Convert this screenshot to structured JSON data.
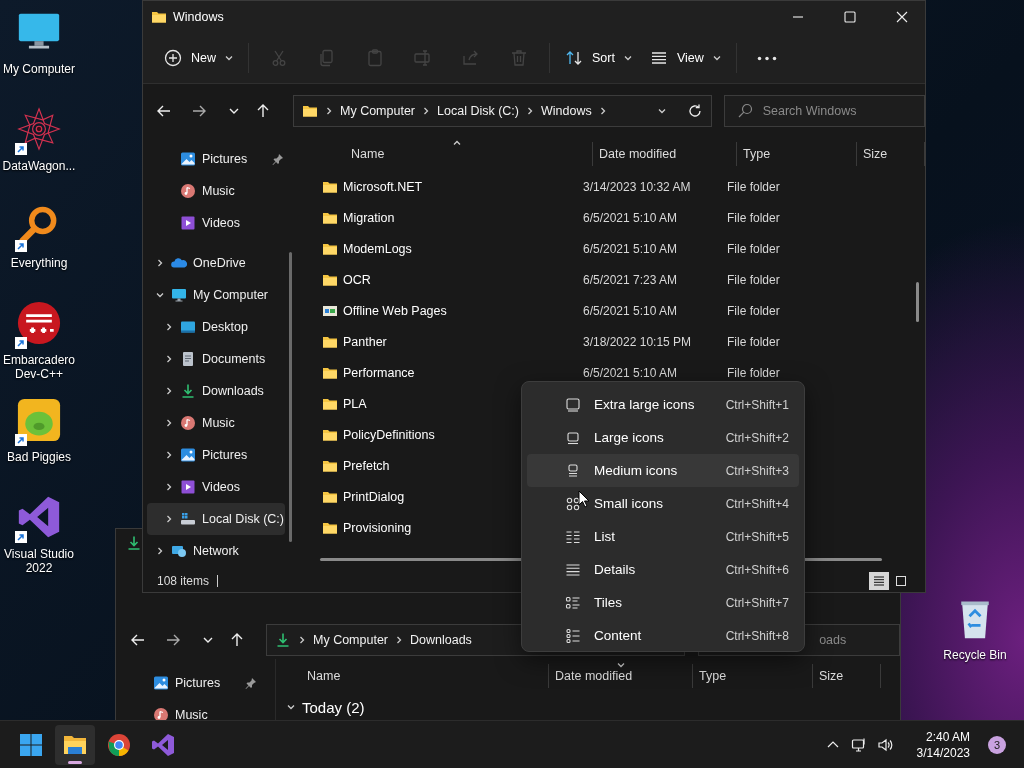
{
  "desktop": {
    "icons": [
      {
        "label": "My Computer",
        "kind": "computer",
        "shortcut": false
      },
      {
        "label": "DataWagon...",
        "kind": "mandala",
        "shortcut": true
      },
      {
        "label": "Everything",
        "kind": "magnifier",
        "shortcut": true
      },
      {
        "label": "Embarcadero Dev-C++",
        "kind": "devcpp",
        "shortcut": true
      },
      {
        "label": "Bad Piggies",
        "kind": "game",
        "shortcut": true
      },
      {
        "label": "Visual Studio 2022",
        "kind": "vs",
        "shortcut": true
      }
    ],
    "recycle_bin": {
      "label": "Recycle Bin"
    }
  },
  "explorer": {
    "title": "Windows",
    "toolbar": [
      {
        "kind": "new",
        "label": "New",
        "disabled": false
      },
      {
        "kind": "cut",
        "disabled": true
      },
      {
        "kind": "copy",
        "disabled": true
      },
      {
        "kind": "paste",
        "disabled": true
      },
      {
        "kind": "rename",
        "disabled": true
      },
      {
        "kind": "share",
        "disabled": true
      },
      {
        "kind": "delete",
        "disabled": true
      },
      {
        "kind": "sort",
        "label": "Sort",
        "disabled": false
      },
      {
        "kind": "view",
        "label": "View",
        "disabled": false
      }
    ],
    "address": [
      "My Computer",
      "Local Disk (C:)",
      "Windows"
    ],
    "search": {
      "placeholder": "Search Windows"
    },
    "quick_access": [
      {
        "label": "Pictures",
        "kind": "pictures",
        "pinned": true
      },
      {
        "label": "Music",
        "kind": "music",
        "pinned": false
      },
      {
        "label": "Videos",
        "kind": "videos",
        "pinned": false
      }
    ],
    "tree": [
      {
        "label": "OneDrive",
        "kind": "onedrive",
        "expanded": false,
        "selected": false
      },
      {
        "label": "My Computer",
        "kind": "computer",
        "expanded": true,
        "selected": false,
        "children": [
          {
            "label": "Desktop",
            "kind": "desktop",
            "expanded": false,
            "selected": false
          },
          {
            "label": "Documents",
            "kind": "documents",
            "expanded": false,
            "selected": false
          },
          {
            "label": "Downloads",
            "kind": "downloads",
            "expanded": false,
            "selected": false
          },
          {
            "label": "Music",
            "kind": "music",
            "expanded": false,
            "selected": false
          },
          {
            "label": "Pictures",
            "kind": "pictures",
            "expanded": false,
            "selected": false
          },
          {
            "label": "Videos",
            "kind": "videos",
            "expanded": false,
            "selected": false
          },
          {
            "label": "Local Disk (C:)",
            "kind": "disk",
            "expanded": false,
            "selected": true
          }
        ]
      },
      {
        "label": "Network",
        "kind": "network",
        "expanded": false,
        "selected": false
      }
    ],
    "columns": [
      {
        "label": "Name",
        "sorted": true,
        "descending": false
      },
      {
        "label": "Date modified",
        "sorted": false
      },
      {
        "label": "Type",
        "sorted": false
      },
      {
        "label": "Size",
        "sorted": false
      }
    ],
    "rows": [
      {
        "name": "Microsoft.NET",
        "date": "3/14/2023 10:32 AM",
        "type": "File folder",
        "kind": "folder"
      },
      {
        "name": "Migration",
        "date": "6/5/2021 5:10 AM",
        "type": "File folder",
        "kind": "folder"
      },
      {
        "name": "ModemLogs",
        "date": "6/5/2021 5:10 AM",
        "type": "File folder",
        "kind": "folder"
      },
      {
        "name": "OCR",
        "date": "6/5/2021 7:23 AM",
        "type": "File folder",
        "kind": "folder"
      },
      {
        "name": "Offline Web Pages",
        "date": "6/5/2021 5:10 AM",
        "type": "File folder",
        "kind": "web"
      },
      {
        "name": "Panther",
        "date": "3/18/2022 10:15 PM",
        "type": "File folder",
        "kind": "folder"
      },
      {
        "name": "Performance",
        "date": "6/5/2021 5:10 AM",
        "type": "File folder",
        "kind": "folder"
      },
      {
        "name": "PLA",
        "kind": "folder"
      },
      {
        "name": "PolicyDefinitions",
        "kind": "folder"
      },
      {
        "name": "Prefetch",
        "kind": "folder"
      },
      {
        "name": "PrintDialog",
        "kind": "folder"
      },
      {
        "name": "Provisioning",
        "kind": "folder"
      }
    ],
    "status": "108 items",
    "views": [
      {
        "kind": "details",
        "selected": true
      },
      {
        "kind": "large",
        "selected": false
      }
    ]
  },
  "back_window": {
    "address": [
      "My Computer",
      "Downloads"
    ],
    "search": {
      "placeholder": "oads"
    },
    "quick_access": [
      {
        "label": "Pictures",
        "kind": "pictures",
        "pinned": true
      },
      {
        "label": "Music",
        "kind": "music",
        "pinned": false
      }
    ],
    "columns": [
      {
        "label": "Name",
        "sorted": false
      },
      {
        "label": "Date modified",
        "sorted": true,
        "descending": true
      },
      {
        "label": "Type",
        "sorted": false
      },
      {
        "label": "Size",
        "sorted": false
      }
    ],
    "groups": [
      {
        "label": "Today (2)",
        "expanded": true
      }
    ]
  },
  "view_menu": {
    "items": [
      {
        "kind": "xl",
        "label": "Extra large icons",
        "shortcut": "Ctrl+Shift+1",
        "selected": false
      },
      {
        "kind": "large",
        "label": "Large icons",
        "shortcut": "Ctrl+Shift+2",
        "selected": false
      },
      {
        "kind": "medium",
        "label": "Medium icons",
        "shortcut": "Ctrl+Shift+3",
        "selected": true
      },
      {
        "kind": "small",
        "label": "Small icons",
        "shortcut": "Ctrl+Shift+4",
        "selected": false
      },
      {
        "kind": "list",
        "label": "List",
        "shortcut": "Ctrl+Shift+5",
        "selected": false
      },
      {
        "kind": "details",
        "label": "Details",
        "shortcut": "Ctrl+Shift+6",
        "selected": false
      },
      {
        "kind": "tiles",
        "label": "Tiles",
        "shortcut": "Ctrl+Shift+7",
        "selected": false
      },
      {
        "kind": "content",
        "label": "Content",
        "shortcut": "Ctrl+Shift+8",
        "selected": false
      }
    ]
  },
  "taskbar": {
    "apps": [
      {
        "kind": "start",
        "selected": false
      },
      {
        "kind": "explorer",
        "selected": true
      },
      {
        "kind": "chrome",
        "selected": false
      },
      {
        "kind": "vs",
        "selected": false
      }
    ],
    "time": "2:40 AM",
    "date": "3/14/2023",
    "notifications": "3"
  }
}
